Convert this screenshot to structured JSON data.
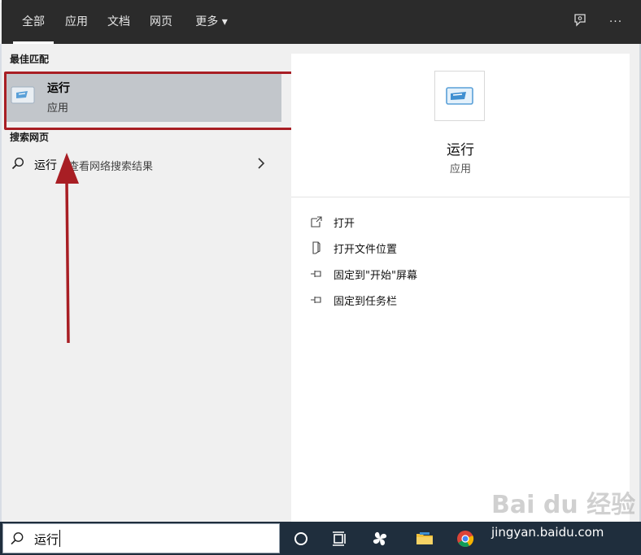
{
  "header": {
    "tabs": [
      {
        "label": "全部",
        "active": true
      },
      {
        "label": "应用"
      },
      {
        "label": "文档"
      },
      {
        "label": "网页"
      },
      {
        "label": "更多"
      }
    ],
    "more_arrow": "▾",
    "more_dots": "···"
  },
  "left": {
    "best_match_label": "最佳匹配",
    "best": {
      "title": "运行",
      "subtitle": "应用"
    },
    "web_label": "搜索网页",
    "web": {
      "query": "运行",
      "hint": "查看网络搜索结果"
    }
  },
  "right": {
    "app_name": "运行",
    "app_type": "应用",
    "actions": [
      {
        "label": "打开",
        "icon": "open-icon"
      },
      {
        "label": "打开文件位置",
        "icon": "file-location-icon"
      },
      {
        "label": "固定到\"开始\"屏幕",
        "icon": "pin-icon"
      },
      {
        "label": "固定到任务栏",
        "icon": "pin-icon"
      }
    ]
  },
  "taskbar": {
    "search_value": "运行",
    "watermark_logo": "Bai du 经验",
    "watermark": "jingyan.baidu.com"
  },
  "colors": {
    "header_bg": "#2b2b2b",
    "selected_bg": "#c2c6cb",
    "highlight_red": "#a81e24",
    "taskbar_bg": "#1f2e3d"
  }
}
